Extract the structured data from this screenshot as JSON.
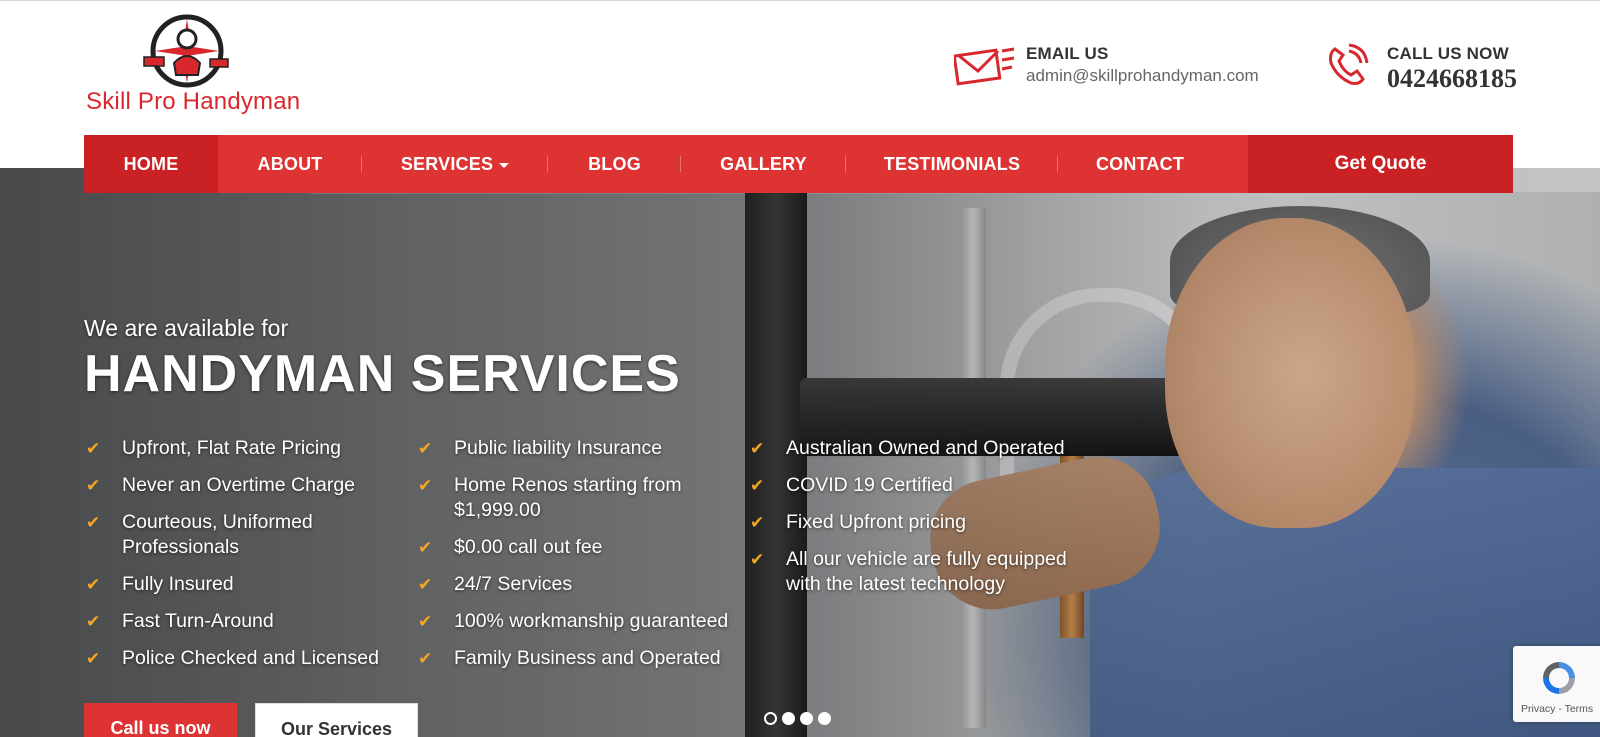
{
  "header": {
    "logo_text": "Skill Pro Handyman",
    "email": {
      "title": "EMAIL US",
      "value": "admin@skillprohandyman.com",
      "icon": "envelope-icon"
    },
    "phone": {
      "title": "CALL US NOW",
      "value": "0424668185",
      "icon": "phone-icon"
    }
  },
  "nav": {
    "items": [
      {
        "label": "HOME",
        "active": true
      },
      {
        "label": "ABOUT"
      },
      {
        "label": "SERVICES",
        "dropdown": true
      },
      {
        "label": "BLOG"
      },
      {
        "label": "GALLERY"
      },
      {
        "label": "TESTIMONIALS"
      },
      {
        "label": "CONTACT"
      }
    ],
    "cta": "Get Quote"
  },
  "hero": {
    "subtitle": "We are available for",
    "title": "HANDYMAN SERVICES",
    "features": {
      "col1": [
        "Upfront, Flat Rate Pricing",
        "Never an Overtime Charge",
        "Courteous, Uniformed\nProfessionals",
        "Fully Insured",
        "Fast Turn-Around",
        "Police Checked and Licensed"
      ],
      "col2": [
        "Public liability Insurance",
        "Home Renos starting from\n$1,999.00",
        "$0.00 call out fee",
        "24/7 Services",
        "100% workmanship guaranteed",
        "Family Business and Operated"
      ],
      "col3": [
        "Australian Owned and Operated",
        "COVID 19 Certified",
        "Fixed Upfront pricing",
        "All our vehicle are fully equipped\nwith the latest technology"
      ]
    },
    "buttons": {
      "primary": "Call us now",
      "secondary": "Our Services"
    },
    "slider": {
      "count": 4,
      "active_index": 0
    }
  },
  "recaptcha": {
    "text": "Privacy - Terms"
  },
  "colors": {
    "brand_red": "#dd3333",
    "brand_red_dark": "#c92124",
    "check_orange": "#f5a623"
  }
}
